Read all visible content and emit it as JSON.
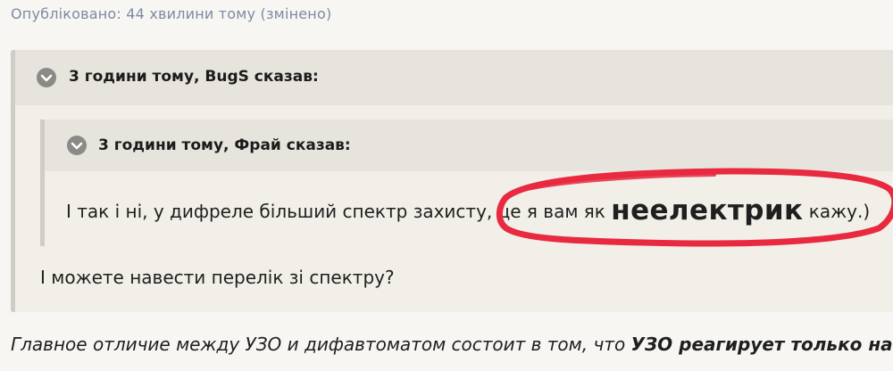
{
  "post": {
    "published_meta": "Опубліковано: 44 хвилини тому (змінено)"
  },
  "outer_quote": {
    "citation": "3 години тому, BugS сказав:",
    "reply_text": "І можете навести перелік зі спектру?"
  },
  "inner_quote": {
    "citation": "3 години тому, Фрай сказав:",
    "text_before": "І так і ні, у дифреле більший спектр захисту, це я вам як ",
    "text_emphasis": "неелектрик",
    "text_after": " кажу.)"
  },
  "following_text": {
    "italic_part": "Главное отличие между УЗО и дифавтоматом состоит в том, что ",
    "bold_part": "УЗО реагирует только на"
  },
  "annotation": {
    "color": "#e8293f",
    "icon": "hand-drawn-ellipse"
  },
  "colors": {
    "page_background": "#f7f6f2",
    "quote_background": "#f1efe8",
    "quote_header": "#e6e4dc",
    "quote_border": "#cfcdc6",
    "meta_text": "#7d8aa3",
    "chevron": "#8a8a86"
  }
}
